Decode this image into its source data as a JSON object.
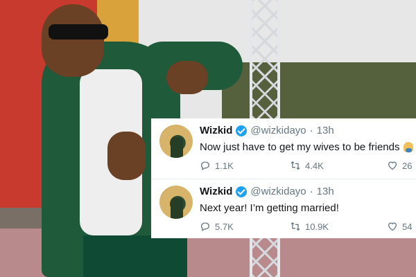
{
  "tweets": [
    {
      "name": "Wizkid",
      "handle": "@wizkidayo",
      "separator": "·",
      "time": "13h",
      "text": "Now just have to get my wives to be friends",
      "emoji": "person-facepalming",
      "replies": "1.1K",
      "retweets": "4.4K",
      "likes": "26"
    },
    {
      "name": "Wizkid",
      "handle": "@wizkidayo",
      "separator": "·",
      "time": "13h",
      "text": "Next year! I’m getting married!",
      "replies": "5.7K",
      "retweets": "10.9K",
      "likes": "54"
    }
  ],
  "icons": {
    "verified": "verified-badge-icon",
    "reply": "reply-icon",
    "retweet": "retweet-icon",
    "like": "heart-icon"
  },
  "colors": {
    "verified_blue": "#1da1f2",
    "muted_text": "#657786",
    "primary_text": "#14171a"
  }
}
